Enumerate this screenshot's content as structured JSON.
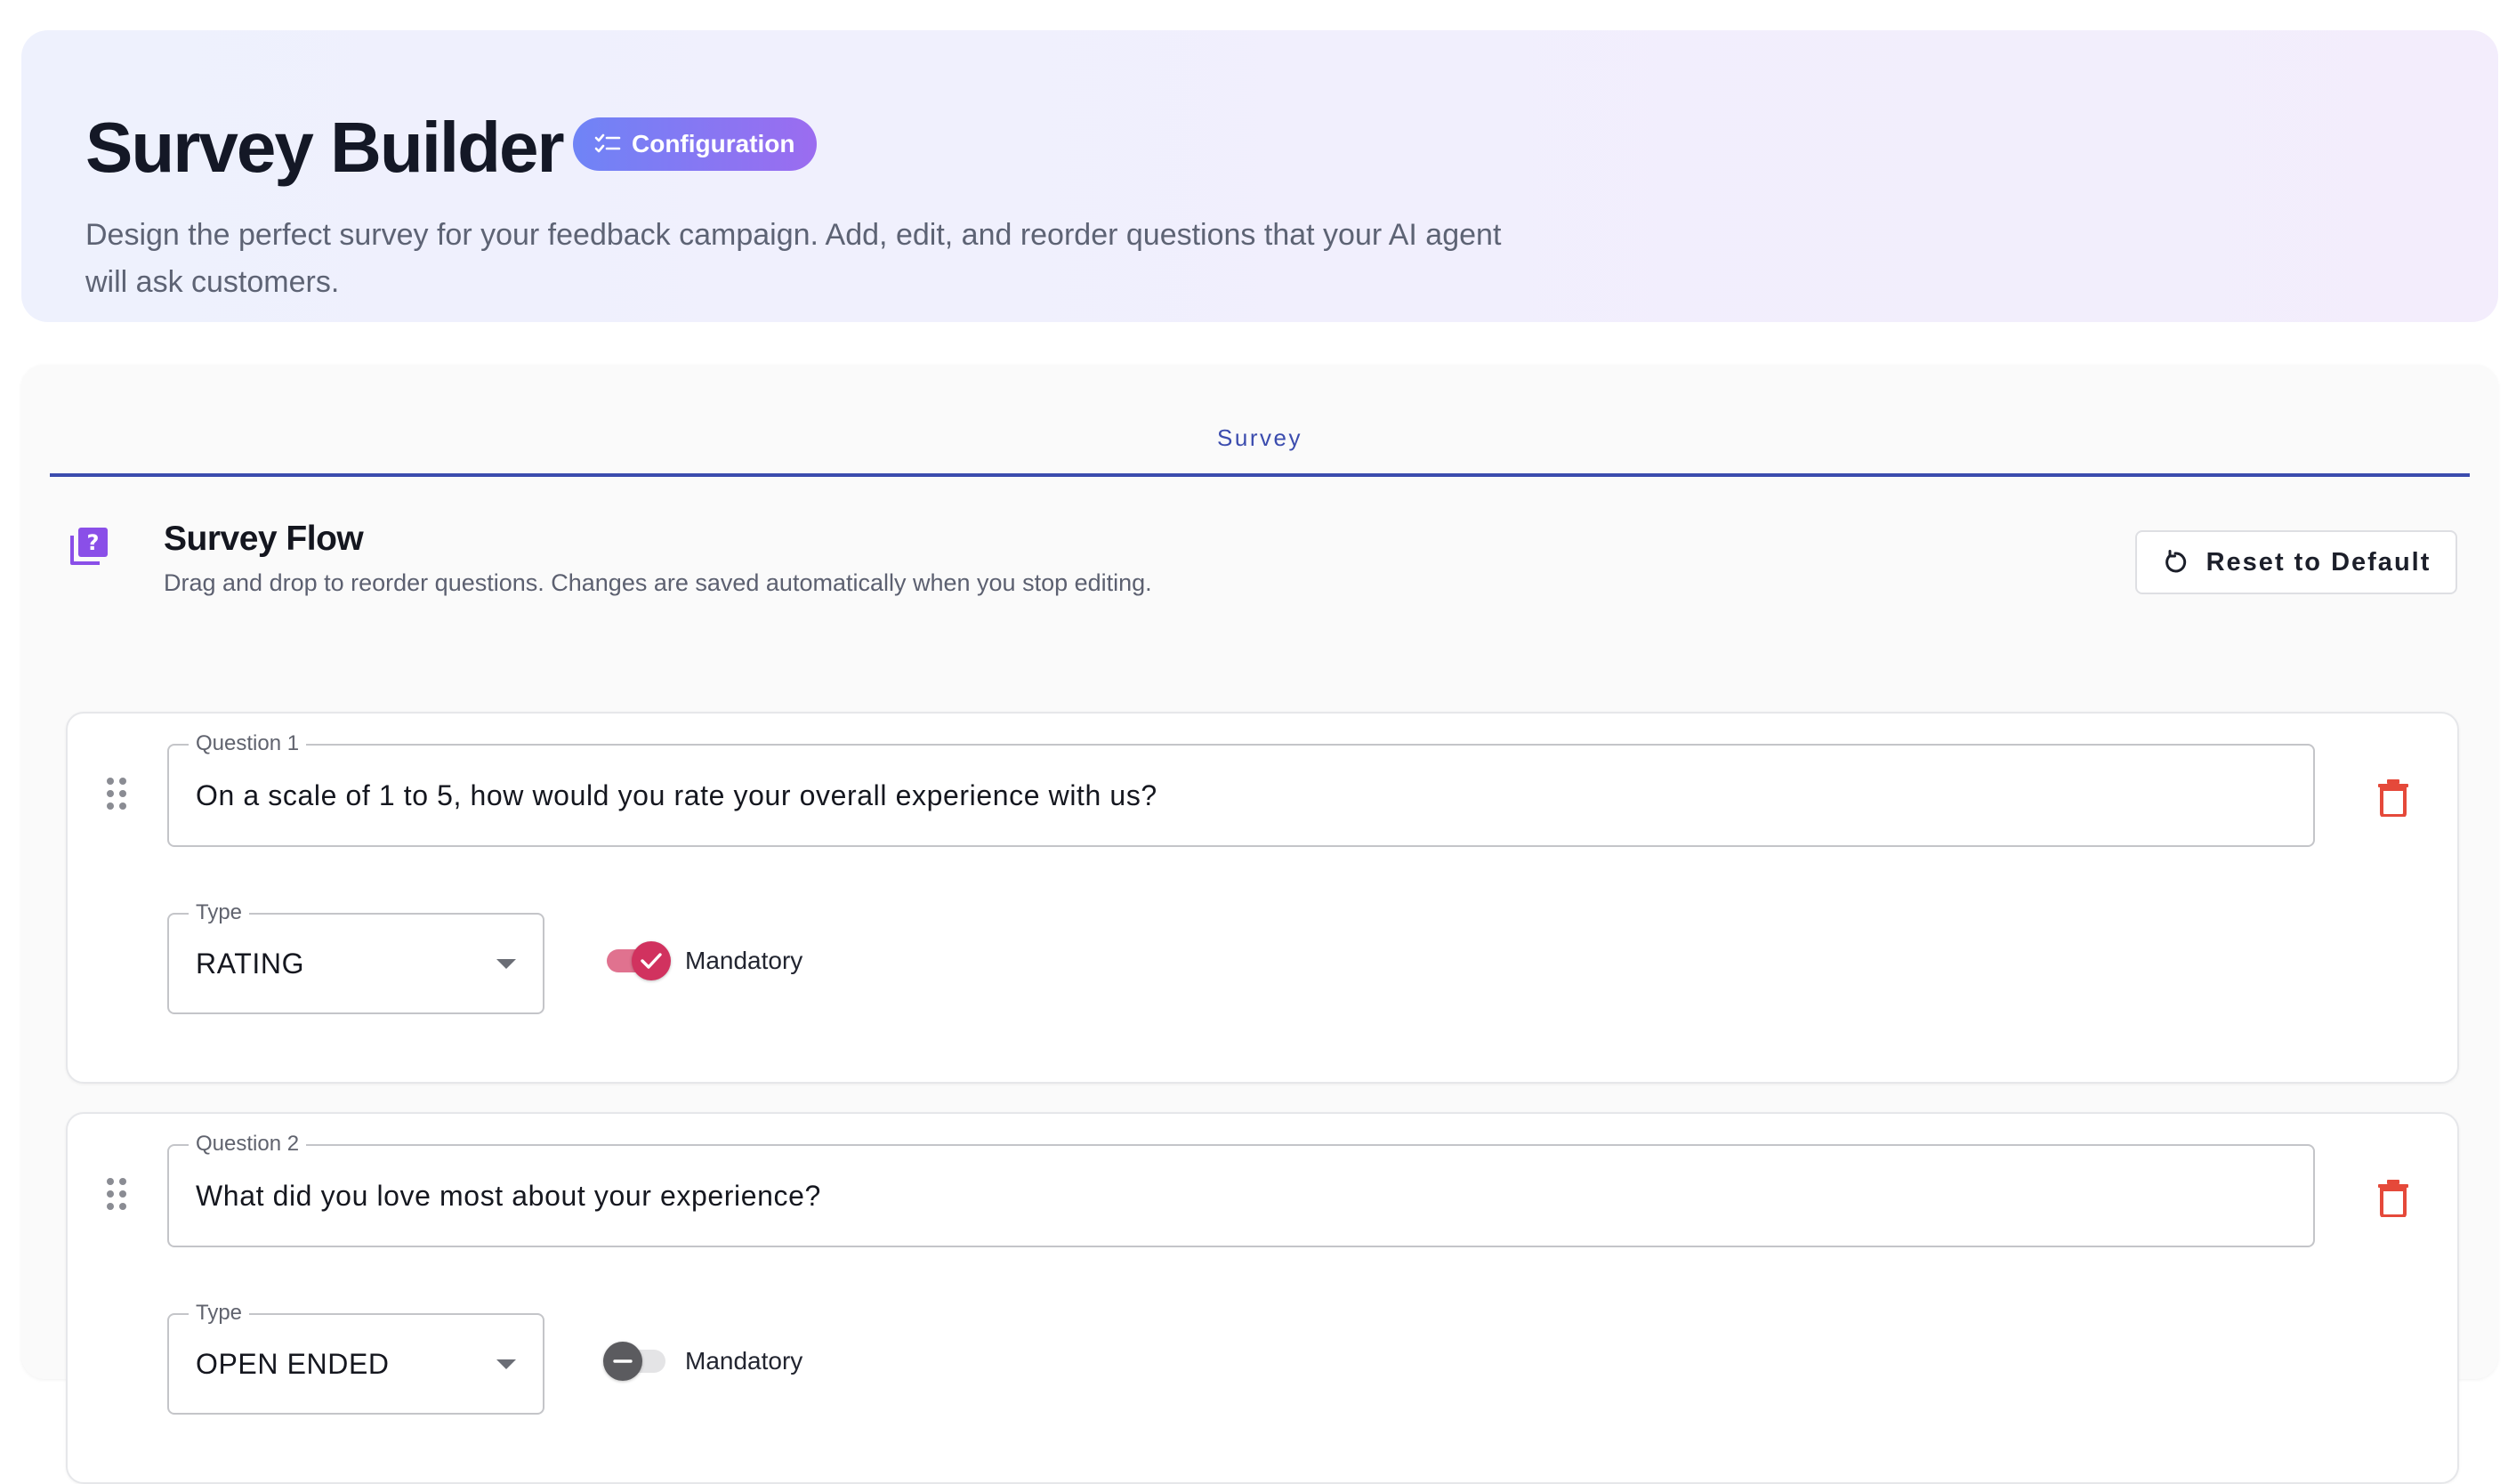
{
  "header": {
    "title": "Survey Builder",
    "badge_label": "Configuration",
    "description": "Design the perfect survey for your feedback campaign. Add, edit, and reorder questions that your AI agent will ask customers."
  },
  "tabs": [
    {
      "label": "Survey",
      "active": true
    }
  ],
  "section": {
    "title": "Survey Flow",
    "subtitle": "Drag and drop to reorder questions. Changes are saved automatically when you stop editing.",
    "reset_label": "Reset to Default"
  },
  "questions": [
    {
      "legend": "Question 1",
      "text": "On a scale of 1 to 5, how would you rate your overall experience with us?",
      "type_legend": "Type",
      "type_value": "RATING",
      "mandatory_label": "Mandatory",
      "mandatory": true
    },
    {
      "legend": "Question 2",
      "text": "What did you love most about your experience?",
      "type_legend": "Type",
      "type_value": "OPEN ENDED",
      "mandatory_label": "Mandatory",
      "mandatory": false
    }
  ],
  "icons": {
    "badge": "checklist-icon",
    "section": "quiz-icon",
    "reset": "refresh-icon",
    "drag": "drag-handle-icon",
    "delete": "trash-icon",
    "select": "caret-down-icon",
    "toggle_on": "check-icon",
    "toggle_off": "minus-icon"
  },
  "colors": {
    "accent": "#3b4cae",
    "badge_start": "#6f84f6",
    "badge_end": "#9b6cf0",
    "section_icon": "#8a4fe8",
    "danger": "#e5493a",
    "toggle_on": "#d1325f"
  }
}
